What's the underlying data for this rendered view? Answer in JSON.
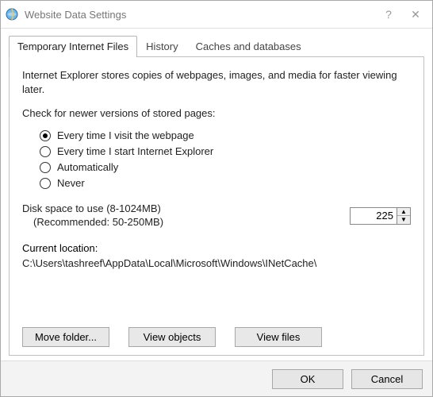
{
  "window": {
    "title": "Website Data Settings"
  },
  "tabs": {
    "t0": "Temporary Internet Files",
    "t1": "History",
    "t2": "Caches and databases"
  },
  "panel": {
    "description": "Internet Explorer stores copies of webpages, images, and media for faster viewing later.",
    "check_label": "Check for newer versions of stored pages:",
    "radios": {
      "r0": "Every time I visit the webpage",
      "r1": "Every time I start Internet Explorer",
      "r2": "Automatically",
      "r3": "Never"
    },
    "disk_label_line1": "Disk space to use (8-1024MB)",
    "disk_label_line2": "(Recommended: 50-250MB)",
    "disk_value": "225",
    "location_label": "Current location:",
    "location_path": "C:\\Users\\tashreef\\AppData\\Local\\Microsoft\\Windows\\INetCache\\",
    "buttons": {
      "move": "Move folder...",
      "view_objects": "View objects",
      "view_files": "View files"
    }
  },
  "footer": {
    "ok": "OK",
    "cancel": "Cancel"
  }
}
